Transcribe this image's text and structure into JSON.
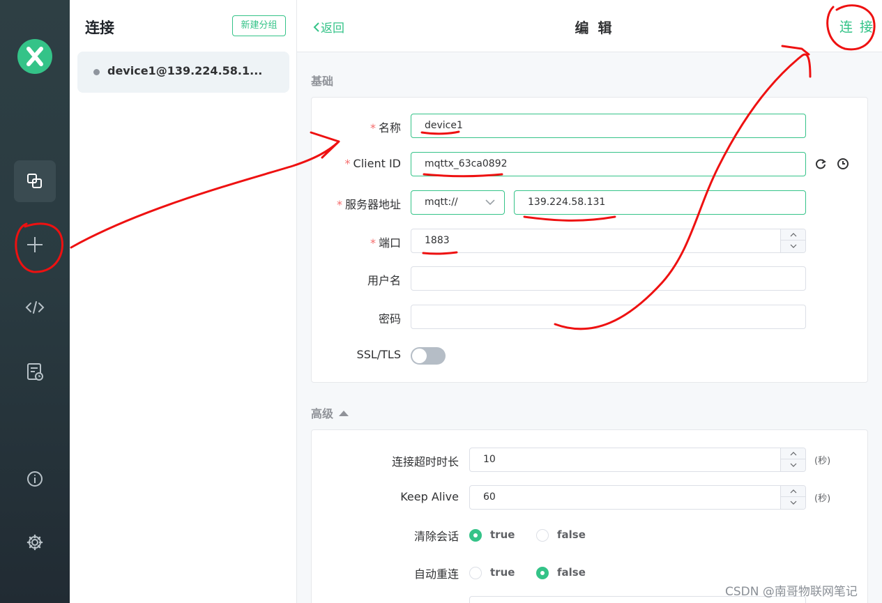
{
  "sidebar": {
    "icons": [
      "logo-icon",
      "connections-icon",
      "plus-icon",
      "code-icon",
      "log-icon",
      "info-icon",
      "gear-icon"
    ]
  },
  "list_panel": {
    "title": "连接",
    "new_group_label": "新建分组",
    "connections": [
      {
        "name": "device1@139.224.58.1...",
        "status_color": "#8f959e"
      }
    ]
  },
  "header": {
    "back_label": "返回",
    "title": "编 辑",
    "connect_label": "连 接"
  },
  "basic": {
    "section_title": "基础",
    "name_label": "名称",
    "name_value": "device1",
    "client_id_label": "Client ID",
    "client_id_value": "mqttx_63ca0892",
    "host_label": "服务器地址",
    "protocol_value": "mqtt://",
    "host_value": "139.224.58.131",
    "port_label": "端口",
    "port_value": "1883",
    "username_label": "用户名",
    "username_value": "",
    "password_label": "密码",
    "password_value": "",
    "ssl_label": "SSL/TLS",
    "ssl_enabled": false
  },
  "advanced": {
    "section_title": "高级",
    "timeout_label": "连接超时时长",
    "timeout_value": "10",
    "timeout_unit": "(秒)",
    "keepalive_label": "Keep Alive",
    "keepalive_value": "60",
    "keepalive_unit": "(秒)",
    "clean_session_label": "清除会话",
    "clean_session_value": "true",
    "reconnect_label": "自动重连",
    "reconnect_value": "false",
    "true_label": "true",
    "false_label": "false"
  },
  "watermark": "CSDN @南哥物联网笔记",
  "colors": {
    "accent": "#34c388",
    "required": "#f56c6c",
    "annotation": "#ee1111",
    "rail": "#2a3b41"
  }
}
